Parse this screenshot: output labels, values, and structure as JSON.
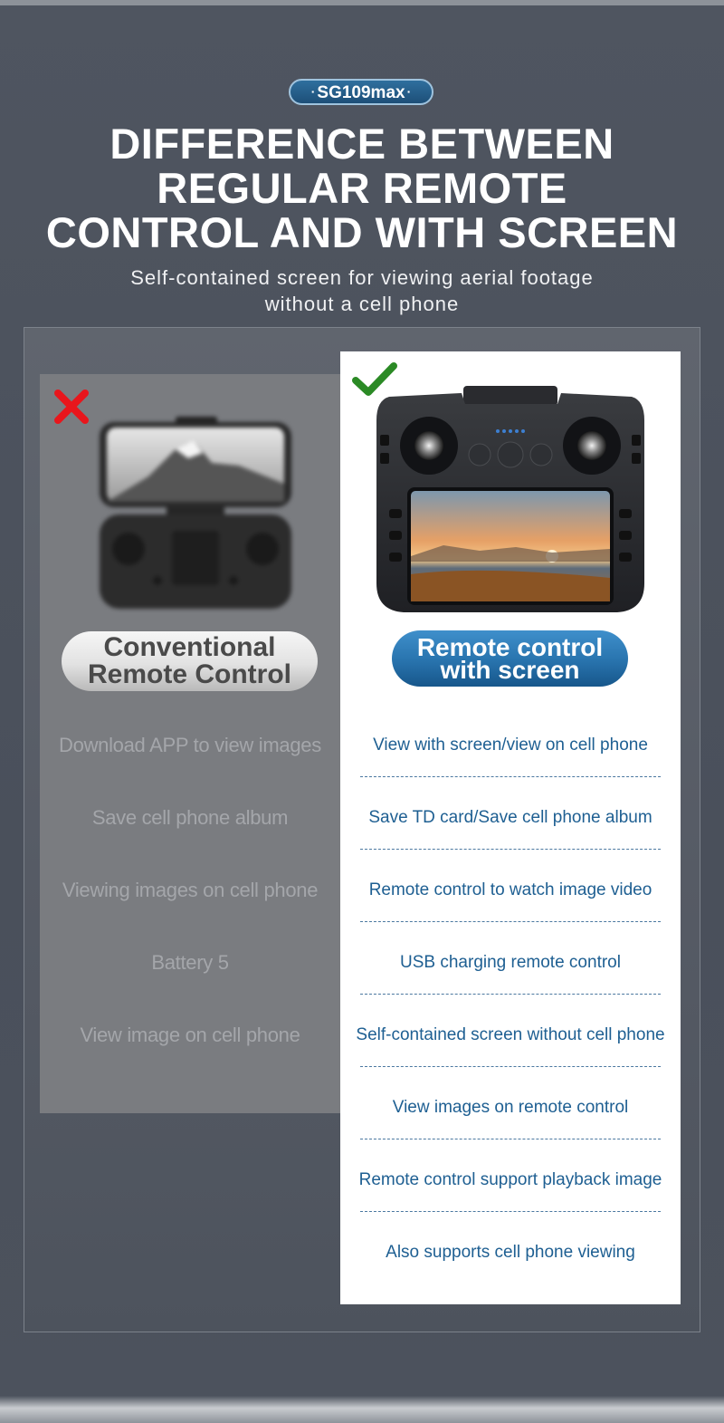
{
  "badge": {
    "label": "SG109max",
    "dot": "·"
  },
  "headline": {
    "line1": "DIFFERENCE BETWEEN",
    "line2": "REGULAR REMOTE",
    "line3": "CONTROL AND WITH SCREEN"
  },
  "subtitle": {
    "line1": "Self-contained screen for viewing aerial footage",
    "line2": "without a cell phone"
  },
  "left": {
    "status_icon": "x-mark-icon",
    "product_image": "conventional-remote-with-phone",
    "title_line1": "Conventional",
    "title_line2": "Remote Control",
    "features": [
      "Download APP to view images",
      "Save cell phone album",
      "Viewing images on cell phone",
      "Battery 5",
      "View image on cell phone"
    ]
  },
  "right": {
    "status_icon": "check-mark-icon",
    "product_image": "screen-remote-control",
    "title_line1": "Remote control",
    "title_line2": "with screen",
    "features": [
      "View with screen/view on cell phone",
      "Save TD card/Save cell phone album",
      "Remote control to watch image video",
      "USB charging remote control",
      "Self-contained screen without cell phone",
      "View images on remote control",
      "Remote control support playback image",
      "Also supports cell phone viewing"
    ]
  },
  "colors": {
    "background": "#4f5560",
    "accent_blue": "#2873ad",
    "feature_text_blue": "#1e5f92",
    "cross_red": "#e8161c",
    "check_green": "#2b8a25"
  }
}
